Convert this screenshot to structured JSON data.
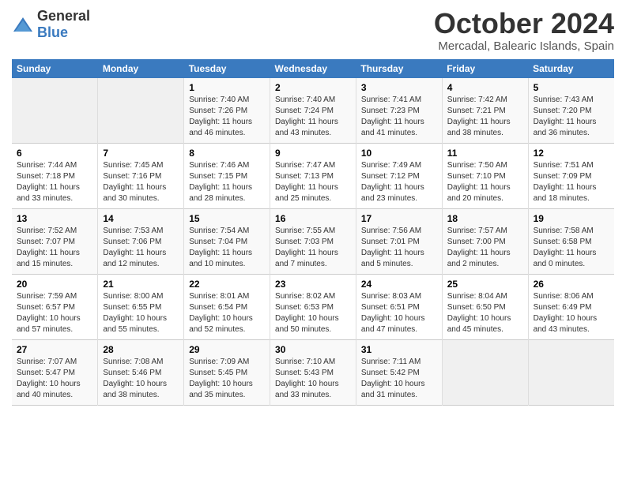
{
  "header": {
    "logo": {
      "general": "General",
      "blue": "Blue"
    },
    "month": "October 2024",
    "location": "Mercadal, Balearic Islands, Spain"
  },
  "weekdays": [
    "Sunday",
    "Monday",
    "Tuesday",
    "Wednesday",
    "Thursday",
    "Friday",
    "Saturday"
  ],
  "weeks": [
    [
      {
        "day": "",
        "info": ""
      },
      {
        "day": "",
        "info": ""
      },
      {
        "day": "1",
        "info": "Sunrise: 7:40 AM\nSunset: 7:26 PM\nDaylight: 11 hours and 46 minutes."
      },
      {
        "day": "2",
        "info": "Sunrise: 7:40 AM\nSunset: 7:24 PM\nDaylight: 11 hours and 43 minutes."
      },
      {
        "day": "3",
        "info": "Sunrise: 7:41 AM\nSunset: 7:23 PM\nDaylight: 11 hours and 41 minutes."
      },
      {
        "day": "4",
        "info": "Sunrise: 7:42 AM\nSunset: 7:21 PM\nDaylight: 11 hours and 38 minutes."
      },
      {
        "day": "5",
        "info": "Sunrise: 7:43 AM\nSunset: 7:20 PM\nDaylight: 11 hours and 36 minutes."
      }
    ],
    [
      {
        "day": "6",
        "info": "Sunrise: 7:44 AM\nSunset: 7:18 PM\nDaylight: 11 hours and 33 minutes."
      },
      {
        "day": "7",
        "info": "Sunrise: 7:45 AM\nSunset: 7:16 PM\nDaylight: 11 hours and 30 minutes."
      },
      {
        "day": "8",
        "info": "Sunrise: 7:46 AM\nSunset: 7:15 PM\nDaylight: 11 hours and 28 minutes."
      },
      {
        "day": "9",
        "info": "Sunrise: 7:47 AM\nSunset: 7:13 PM\nDaylight: 11 hours and 25 minutes."
      },
      {
        "day": "10",
        "info": "Sunrise: 7:49 AM\nSunset: 7:12 PM\nDaylight: 11 hours and 23 minutes."
      },
      {
        "day": "11",
        "info": "Sunrise: 7:50 AM\nSunset: 7:10 PM\nDaylight: 11 hours and 20 minutes."
      },
      {
        "day": "12",
        "info": "Sunrise: 7:51 AM\nSunset: 7:09 PM\nDaylight: 11 hours and 18 minutes."
      }
    ],
    [
      {
        "day": "13",
        "info": "Sunrise: 7:52 AM\nSunset: 7:07 PM\nDaylight: 11 hours and 15 minutes."
      },
      {
        "day": "14",
        "info": "Sunrise: 7:53 AM\nSunset: 7:06 PM\nDaylight: 11 hours and 12 minutes."
      },
      {
        "day": "15",
        "info": "Sunrise: 7:54 AM\nSunset: 7:04 PM\nDaylight: 11 hours and 10 minutes."
      },
      {
        "day": "16",
        "info": "Sunrise: 7:55 AM\nSunset: 7:03 PM\nDaylight: 11 hours and 7 minutes."
      },
      {
        "day": "17",
        "info": "Sunrise: 7:56 AM\nSunset: 7:01 PM\nDaylight: 11 hours and 5 minutes."
      },
      {
        "day": "18",
        "info": "Sunrise: 7:57 AM\nSunset: 7:00 PM\nDaylight: 11 hours and 2 minutes."
      },
      {
        "day": "19",
        "info": "Sunrise: 7:58 AM\nSunset: 6:58 PM\nDaylight: 11 hours and 0 minutes."
      }
    ],
    [
      {
        "day": "20",
        "info": "Sunrise: 7:59 AM\nSunset: 6:57 PM\nDaylight: 10 hours and 57 minutes."
      },
      {
        "day": "21",
        "info": "Sunrise: 8:00 AM\nSunset: 6:55 PM\nDaylight: 10 hours and 55 minutes."
      },
      {
        "day": "22",
        "info": "Sunrise: 8:01 AM\nSunset: 6:54 PM\nDaylight: 10 hours and 52 minutes."
      },
      {
        "day": "23",
        "info": "Sunrise: 8:02 AM\nSunset: 6:53 PM\nDaylight: 10 hours and 50 minutes."
      },
      {
        "day": "24",
        "info": "Sunrise: 8:03 AM\nSunset: 6:51 PM\nDaylight: 10 hours and 47 minutes."
      },
      {
        "day": "25",
        "info": "Sunrise: 8:04 AM\nSunset: 6:50 PM\nDaylight: 10 hours and 45 minutes."
      },
      {
        "day": "26",
        "info": "Sunrise: 8:06 AM\nSunset: 6:49 PM\nDaylight: 10 hours and 43 minutes."
      }
    ],
    [
      {
        "day": "27",
        "info": "Sunrise: 7:07 AM\nSunset: 5:47 PM\nDaylight: 10 hours and 40 minutes."
      },
      {
        "day": "28",
        "info": "Sunrise: 7:08 AM\nSunset: 5:46 PM\nDaylight: 10 hours and 38 minutes."
      },
      {
        "day": "29",
        "info": "Sunrise: 7:09 AM\nSunset: 5:45 PM\nDaylight: 10 hours and 35 minutes."
      },
      {
        "day": "30",
        "info": "Sunrise: 7:10 AM\nSunset: 5:43 PM\nDaylight: 10 hours and 33 minutes."
      },
      {
        "day": "31",
        "info": "Sunrise: 7:11 AM\nSunset: 5:42 PM\nDaylight: 10 hours and 31 minutes."
      },
      {
        "day": "",
        "info": ""
      },
      {
        "day": "",
        "info": ""
      }
    ]
  ]
}
